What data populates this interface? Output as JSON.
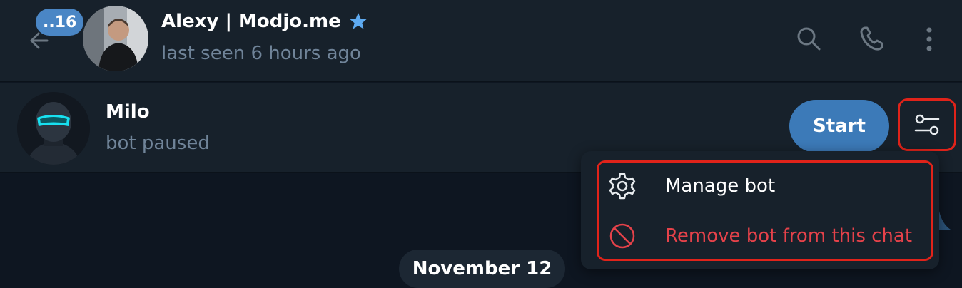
{
  "header": {
    "unread_count": "..16",
    "contact_name": "Alexy | Modjo.me",
    "contact_status": "last seen 6 hours ago",
    "verified_icon": "star-icon",
    "icons": [
      "back-arrow-icon",
      "search-icon",
      "phone-icon",
      "more-vertical-icon"
    ]
  },
  "bot": {
    "name": "Milo",
    "status": "bot paused",
    "start_label": "Start",
    "settings_icon": "sliders-icon"
  },
  "menu": {
    "items": [
      {
        "label": "Manage bot",
        "icon": "gear-icon",
        "color": "#ffffff"
      },
      {
        "label": "Remove bot from this chat",
        "icon": "ban-icon",
        "color": "#e5424a"
      }
    ]
  },
  "chat": {
    "date_label": "November 12"
  },
  "colors": {
    "header_bg": "#17212b",
    "chat_bg": "#0e1621",
    "accent": "#3c7ab8",
    "badge": "#4a86c5",
    "secondary_text": "#708499",
    "danger": "#e5424a",
    "annotation_red": "#e0231a",
    "star": "#5eaaf0"
  }
}
